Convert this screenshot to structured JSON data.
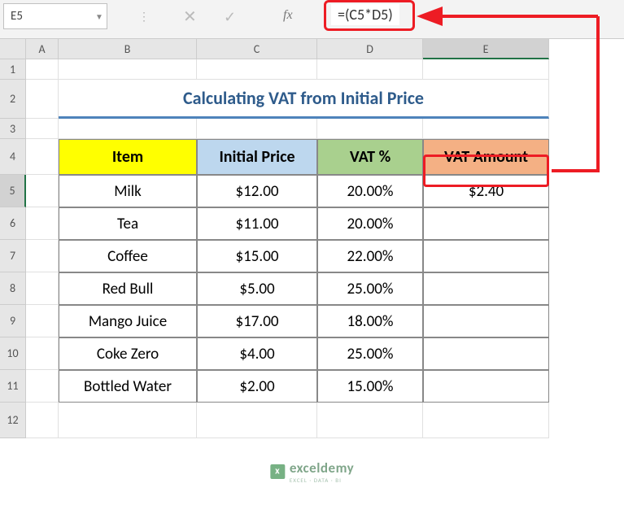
{
  "name_box": "E5",
  "fx_label": "fx",
  "formula": "=(C5*D5)",
  "columns": [
    "A",
    "B",
    "C",
    "D",
    "E"
  ],
  "rows": [
    "1",
    "2",
    "3",
    "4",
    "5",
    "6",
    "7",
    "8",
    "9",
    "10",
    "11",
    "12"
  ],
  "title": "Calculating VAT from Initial Price",
  "headers": {
    "item": "Item",
    "price": "Initial Price",
    "vat": "VAT %",
    "amount": "VAT Amount"
  },
  "data": [
    {
      "item": "Milk",
      "price": "$12.00",
      "vat": "20.00%",
      "amount": "$2.40"
    },
    {
      "item": "Tea",
      "price": "$11.00",
      "vat": "20.00%",
      "amount": ""
    },
    {
      "item": "Coffee",
      "price": "$15.00",
      "vat": "22.00%",
      "amount": ""
    },
    {
      "item": "Red Bull",
      "price": "$5.00",
      "vat": "25.00%",
      "amount": ""
    },
    {
      "item": "Mango Juice",
      "price": "$17.00",
      "vat": "18.00%",
      "amount": ""
    },
    {
      "item": "Coke Zero",
      "price": "$4.00",
      "vat": "25.00%",
      "amount": ""
    },
    {
      "item": "Bottled Water",
      "price": "$2.00",
      "vat": "15.00%",
      "amount": ""
    }
  ],
  "watermark": {
    "brand": "exceldemy",
    "sub": "EXCEL · DATA · BI"
  },
  "chart_data": {
    "type": "table",
    "title": "Calculating VAT from Initial Price",
    "columns": [
      "Item",
      "Initial Price",
      "VAT %",
      "VAT Amount"
    ],
    "rows": [
      [
        "Milk",
        12.0,
        0.2,
        2.4
      ],
      [
        "Tea",
        11.0,
        0.2,
        null
      ],
      [
        "Coffee",
        15.0,
        0.22,
        null
      ],
      [
        "Red Bull",
        5.0,
        0.25,
        null
      ],
      [
        "Mango Juice",
        17.0,
        0.18,
        null
      ],
      [
        "Coke Zero",
        4.0,
        0.25,
        null
      ],
      [
        "Bottled Water",
        2.0,
        0.15,
        null
      ]
    ]
  }
}
